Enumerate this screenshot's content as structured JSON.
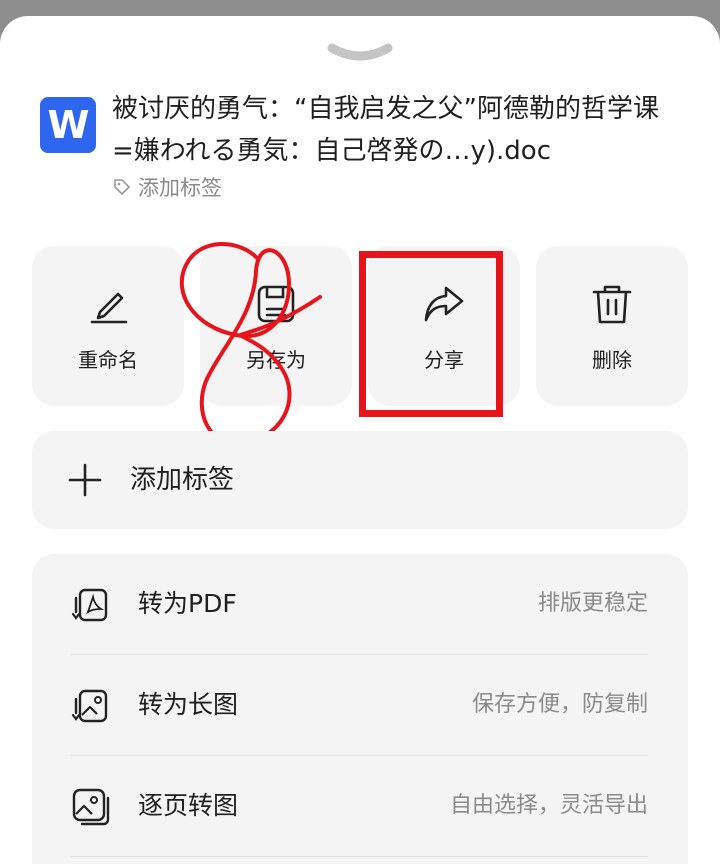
{
  "document": {
    "icon_letter": "W",
    "title": "被讨厌的勇气：“自我启发之父”阿德勒的哲学课=嫌われる勇気：自己啓発の…y).doc",
    "tag_label": "添加标签"
  },
  "actions": [
    {
      "label": "重命名",
      "icon": "pencil-icon"
    },
    {
      "label": "另存为",
      "icon": "save-icon"
    },
    {
      "label": "分享",
      "icon": "share-icon"
    },
    {
      "label": "删除",
      "icon": "trash-icon"
    }
  ],
  "add_tag": {
    "label": "添加标签",
    "icon": "plus-icon"
  },
  "conversions": [
    {
      "title": "转为PDF",
      "desc": "排版更稳定",
      "icon": "convert-pdf-icon"
    },
    {
      "title": "转为长图",
      "desc": "保存方便，防复制",
      "icon": "convert-long-image-icon"
    },
    {
      "title": "逐页转图",
      "desc": "自由选择，灵活导出",
      "icon": "page-to-image-icon"
    }
  ],
  "colors": {
    "accent_blue": "#2f66f0",
    "highlight_red": "#e8141b",
    "card_bg": "#f4f4f4"
  }
}
